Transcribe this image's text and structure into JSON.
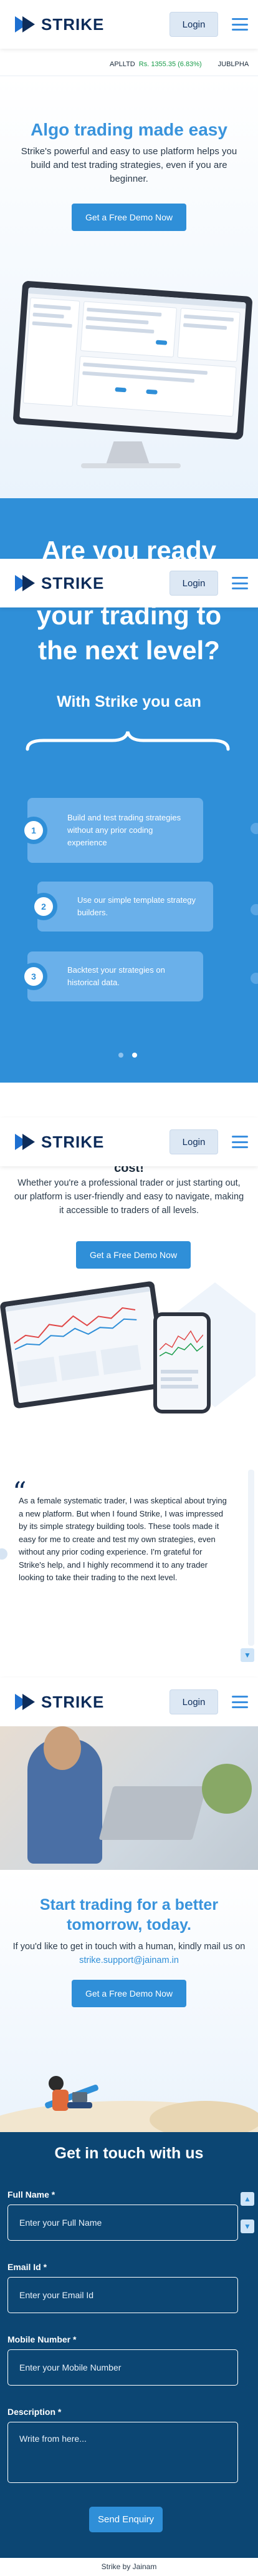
{
  "header": {
    "brand": "STRIKE",
    "login_label": "Login"
  },
  "ticker": {
    "symbol": "APLLTD",
    "value": "Rs. 1355.35 (6.83%)",
    "next_symbol": "JUBLPHA"
  },
  "hero": {
    "title": "Algo trading made easy",
    "description": "Strike's powerful and easy to use platform helps you build and test trading strategies, even if you are beginner.",
    "cta_label": "Get a Free Demo Now"
  },
  "ready_section": {
    "question_top": "Are you ready",
    "question_bottom": "your trading to the next level?",
    "subheading": "With Strike you can",
    "steps": [
      {
        "number": "1",
        "text": "Build and test trading strategies without any prior coding experience"
      },
      {
        "number": "2",
        "text": "Use our simple template strategy builders."
      },
      {
        "number": "3",
        "text": "Backtest your strategies on historical data."
      }
    ]
  },
  "platform_section": {
    "title_fragment": "cost!",
    "description": "Whether you're a professional trader or just starting out, our platform is user-friendly and easy to navigate, making it accessible to traders of all levels.",
    "cta_label": "Get a Free Demo Now"
  },
  "testimonial": {
    "text": "As a female systematic trader, I was skeptical about trying a new platform. But when I found Strike, I was impressed by its simple strategy building tools. These tools made it easy for me to create and test my own strategies, even without any prior coding experience. I'm grateful for Strike's help, and I highly recommend it to any trader looking to take their trading to the next level."
  },
  "contact_hero": {
    "title_line1": "Start trading for a better",
    "title_line2": "tomorrow, today.",
    "description": "If you'd like to get in touch with a human, kindly mail us on",
    "email": "strike.support@jainam.in",
    "cta_label": "Get a Free Demo Now"
  },
  "contact_form": {
    "title": "Get in touch with us",
    "name_label": "Full Name *",
    "name_placeholder": "Enter your Full Name",
    "email_label": "Email Id *",
    "email_placeholder": "Enter your Email Id",
    "mobile_label": "Mobile Number *",
    "mobile_placeholder": "Enter your Mobile Number",
    "description_label": "Description *",
    "description_placeholder": "Write from here...",
    "submit_label": "Send Enquiry"
  },
  "footer": {
    "text": "Strike by Jainam"
  },
  "colors": {
    "primary": "#2f8fd8",
    "navy": "#0d2c5a",
    "form_bg": "#0c4673",
    "gain": "#1a9c4a"
  }
}
